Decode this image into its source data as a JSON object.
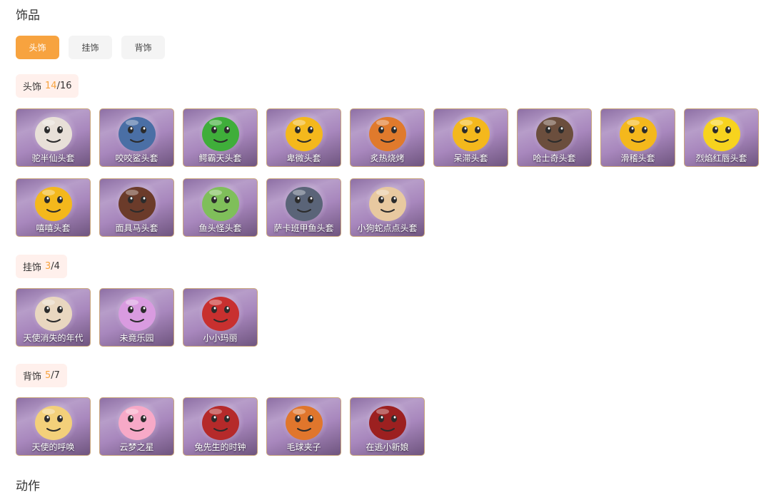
{
  "page_title": "饰品",
  "tabs": [
    {
      "label": "头饰",
      "active": true
    },
    {
      "label": "挂饰",
      "active": false
    },
    {
      "label": "背饰",
      "active": false
    }
  ],
  "sections": {
    "head": {
      "label": "头饰",
      "owned": "14",
      "total": "/16",
      "items": [
        {
          "name": "驼半仙头套",
          "icon": "bear-mask-icon",
          "color": "#e8e0d8"
        },
        {
          "name": "咬咬鲨头套",
          "icon": "shark-icon",
          "color": "#4a6fa5"
        },
        {
          "name": "鳄霸天头套",
          "icon": "crocodile-icon",
          "color": "#3fae3a"
        },
        {
          "name": "卑微头套",
          "icon": "worried-face-icon",
          "color": "#f4b81c"
        },
        {
          "name": "炙热烧烤",
          "icon": "bread-icon",
          "color": "#e07a2c"
        },
        {
          "name": "呆滞头套",
          "icon": "blank-face-icon",
          "color": "#f4b81c"
        },
        {
          "name": "哈士奇头套",
          "icon": "husky-icon",
          "color": "#6b4e3d"
        },
        {
          "name": "滑稽头套",
          "icon": "smirk-face-icon",
          "color": "#f4b81c"
        },
        {
          "name": "烈焰红唇头套",
          "icon": "pikachu-icon",
          "color": "#f7d31e"
        },
        {
          "name": "嘻嘻头套",
          "icon": "grin-face-icon",
          "color": "#f4b81c"
        },
        {
          "name": "面具马头套",
          "icon": "horse-icon",
          "color": "#6b3b2a"
        },
        {
          "name": "鱼头怪头套",
          "icon": "fish-head-icon",
          "color": "#7fbf5a"
        },
        {
          "name": "萨卡班甲鱼头套",
          "icon": "fish-icon",
          "color": "#5a6478"
        },
        {
          "name": "小狗蛇点点头套",
          "icon": "snake-icon",
          "color": "#e8c9a0"
        }
      ]
    },
    "hanging": {
      "label": "挂饰",
      "owned": "3",
      "total": "/4",
      "items": [
        {
          "name": "天使消失的年代",
          "icon": "angel-doll-icon",
          "color": "#e9d7c0"
        },
        {
          "name": "未竟乐园",
          "icon": "fairy-doll-icon",
          "color": "#d99be0"
        },
        {
          "name": "小小玛丽",
          "icon": "mary-doll-icon",
          "color": "#c8302f"
        }
      ]
    },
    "back": {
      "label": "背饰",
      "owned": "5",
      "total": "/7",
      "items": [
        {
          "name": "天使的呼唤",
          "icon": "angel-wings-icon",
          "color": "#f3d07a"
        },
        {
          "name": "云梦之星",
          "icon": "unicorn-icon",
          "color": "#f7a9c7"
        },
        {
          "name": "兔先生的时钟",
          "icon": "rabbit-clock-icon",
          "color": "#b52a2a"
        },
        {
          "name": "毛球夹子",
          "icon": "fox-soldier-icon",
          "color": "#e0762c"
        },
        {
          "name": "在逃小新娘",
          "icon": "bride-dress-icon",
          "color": "#9c2020"
        }
      ]
    }
  },
  "next_title": "动作"
}
